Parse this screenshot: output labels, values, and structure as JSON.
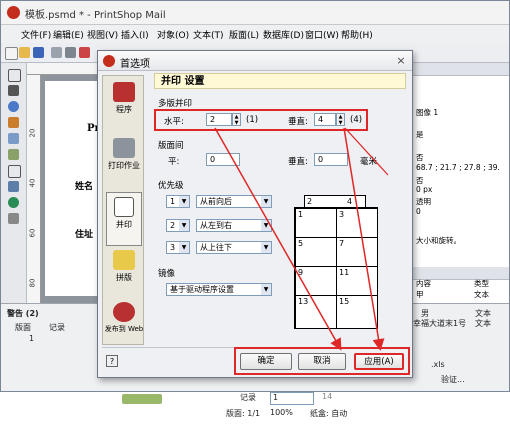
{
  "app": {
    "title": "模板.psmd * - PrintShop Mail",
    "menus": [
      "文件(F)",
      "编辑(E)",
      "视图(V)",
      "插入(I)",
      "对象(O)",
      "文本(T)",
      "版面(L)",
      "数据库(D)",
      "窗口(W)",
      "帮助(H)"
    ]
  },
  "document": {
    "ruler_marks": [
      "20",
      "40",
      "60",
      "80"
    ],
    "text1": "Pri",
    "text2": "姓名",
    "text3": "住址"
  },
  "right_panel": {
    "rows": [
      "图像 1",
      "是",
      "否",
      "68.7 ; 21.7 ; 27.8 ; 39.",
      "否",
      "0 px",
      "透明",
      "0"
    ],
    "hint": "大小和旋转。",
    "table_headers": [
      "内容",
      "类型"
    ],
    "table_rows": [
      [
        "甲",
        "文本"
      ],
      [
        "男",
        "文本"
      ],
      [
        "幸福大道末1号",
        "文本"
      ]
    ],
    "footer": "验证..."
  },
  "bottom": {
    "warnings_title": "警告 (2)",
    "col_headers": [
      "版面",
      "记录"
    ],
    "row1": "1",
    "xls_label": ".xls"
  },
  "statusbar": {
    "record_label": "记录",
    "record_value": "1",
    "record_total": "14",
    "layout_text": "版面: 1/1",
    "zoom_text": "100%",
    "paper_text": "纸盒: 自动"
  },
  "dialog": {
    "title": "首选项",
    "close": "×",
    "sidebar": [
      {
        "label": "程序",
        "icon": "app-icon"
      },
      {
        "label": "打印作业",
        "icon": "printer-icon"
      },
      {
        "label": "并印",
        "icon": "impose-icon"
      },
      {
        "label": "拼版",
        "icon": "layout-icon"
      },
      {
        "label": "发布到 Web",
        "icon": "web-icon"
      }
    ],
    "header": "并印 设置",
    "multi_section": {
      "label": "多版并印",
      "horizontal_label": "水平:",
      "horizontal_value": "2",
      "horizontal_result": "(1)",
      "vertical_label": "垂直:",
      "vertical_value": "4",
      "vertical_result": "(4)"
    },
    "spacing_section": {
      "label": "版面间",
      "h_label": "平:",
      "h_value": "0",
      "v_label": "垂直:",
      "v_value": "0",
      "unit": "毫米"
    },
    "priority_section": {
      "label": "优先级",
      "rows": [
        {
          "num": "1",
          "option": "从前向后"
        },
        {
          "num": "2",
          "option": "从左到右"
        },
        {
          "num": "3",
          "option": "从上往下"
        }
      ]
    },
    "mirror_section": {
      "label": "镜像",
      "option": "基于驱动程序设置"
    },
    "grid_cells": [
      "2",
      "4",
      "1",
      "3",
      "5",
      "7",
      "9",
      "11",
      "13",
      "15"
    ],
    "buttons": {
      "ok": "确定",
      "cancel": "取消",
      "apply": "应用(A)"
    },
    "help": "?"
  },
  "colors": {
    "accent": "#e02727",
    "header_bg": "#fff9d6"
  }
}
